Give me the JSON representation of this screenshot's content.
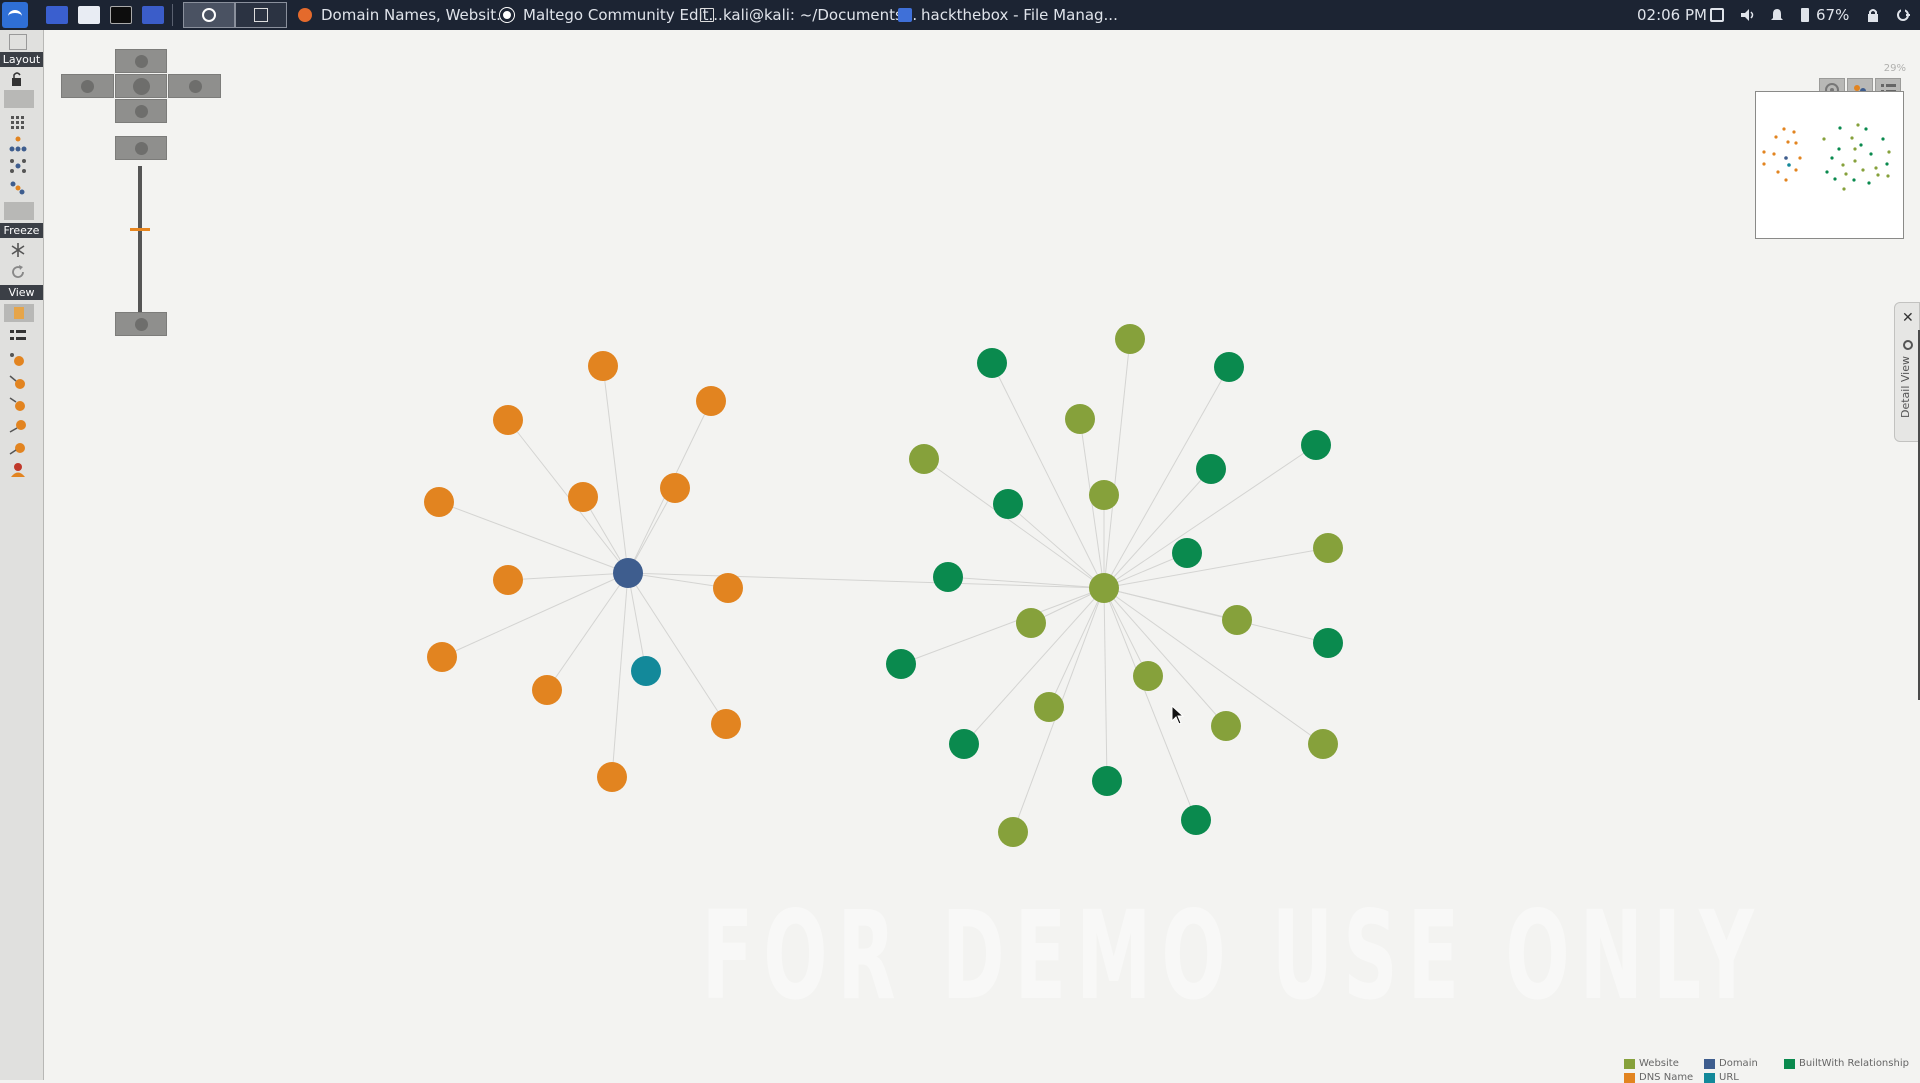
{
  "taskbar": {
    "tasks": [
      {
        "label": "Domain Names, Websit...",
        "icon": "firefox-icon"
      },
      {
        "label": "Maltego Community Edit...",
        "icon": "maltego-icon"
      },
      {
        "label": "kali@kali: ~/Documents...",
        "icon": "terminal-icon"
      },
      {
        "label": "hackthebox - File Manag...",
        "icon": "folder-icon"
      }
    ],
    "clock": "02:06 PM",
    "battery": "67%"
  },
  "left_toolbar": {
    "layout_label": "Layout",
    "freeze_label": "Freeze",
    "view_label": "View"
  },
  "canvas": {
    "zoom_percent": "29%",
    "detail_view_label": "Detail View",
    "watermark": "FOR DEMO USE ONLY",
    "legend": [
      {
        "label": "Website",
        "color": "#86a13b"
      },
      {
        "label": "Domain",
        "color": "#3e5d8e"
      },
      {
        "label": "BuiltWith Relationship",
        "color": "#0a8a4e"
      },
      {
        "label": "DNS Name",
        "color": "#e28420"
      },
      {
        "label": "URL",
        "color": "#13899a"
      }
    ]
  },
  "colors": {
    "dns": "#e28420",
    "domain": "#3e5d8e",
    "url": "#13899a",
    "website": "#86a13b",
    "builtwith": "#0a8a4e"
  }
}
